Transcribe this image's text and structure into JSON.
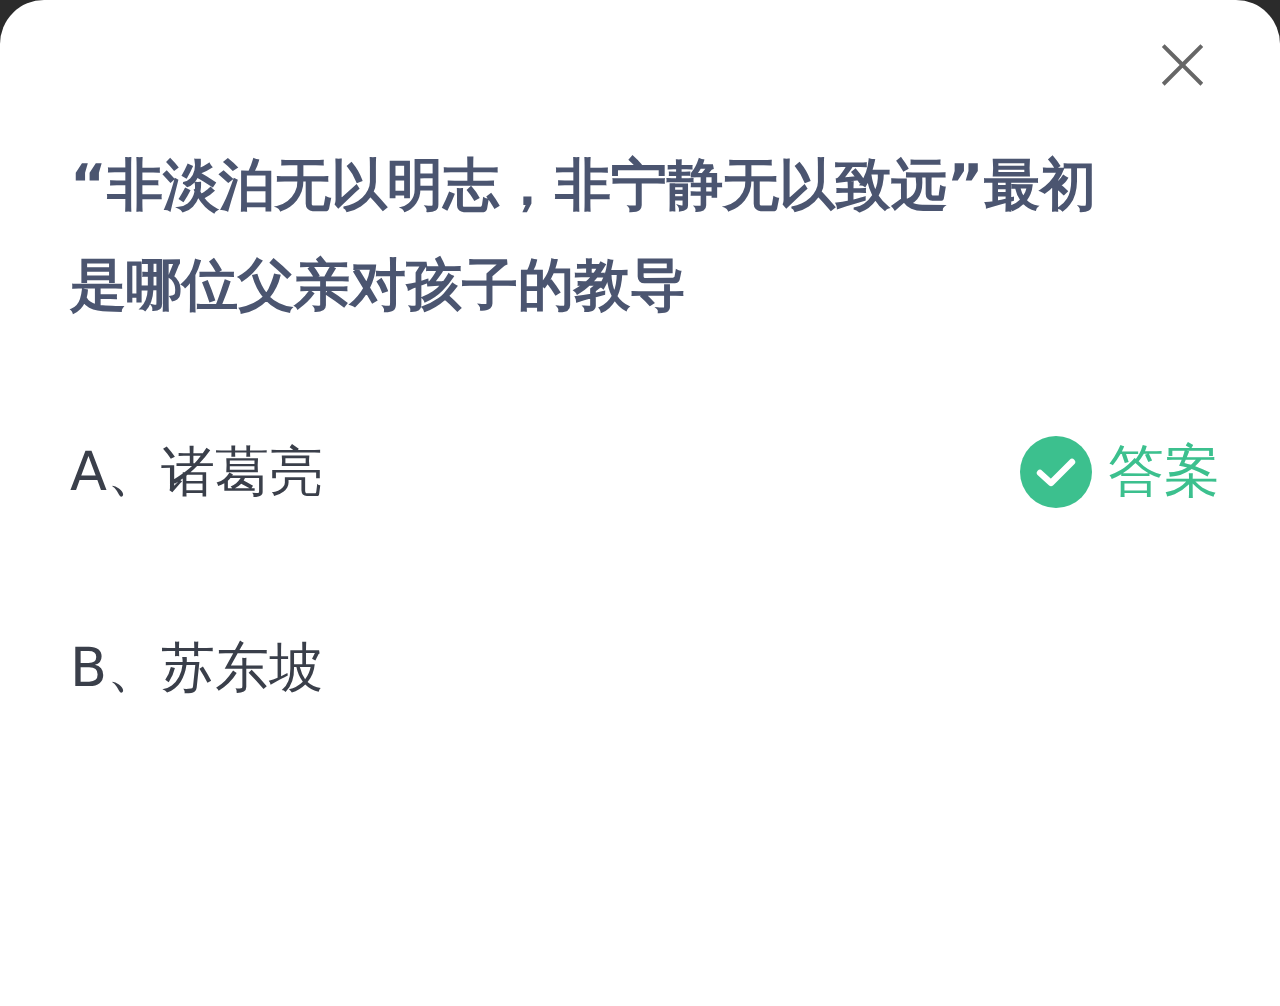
{
  "dialog": {
    "close": "×"
  },
  "question": "“非淡泊无以明志，非宁静无以致远”最初是哪位父亲对孩子的教导",
  "options": [
    {
      "text": "A、诸葛亮",
      "is_answer": true,
      "badge": "答案"
    },
    {
      "text": "B、苏东坡",
      "is_answer": false
    }
  ]
}
